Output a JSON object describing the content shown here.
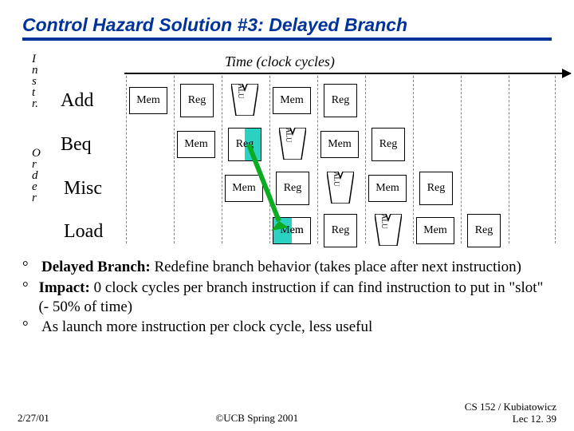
{
  "title": "Control Hazard Solution #3: Delayed Branch",
  "vlabel_top": {
    "c": [
      "I",
      "n",
      "s",
      "t",
      "r."
    ]
  },
  "vlabel_bot": {
    "c": [
      "O",
      "r",
      "d",
      "e",
      "r"
    ]
  },
  "time_label": "Time (clock cycles)",
  "instr": {
    "add": "Add",
    "beq": "Beq",
    "misc": "Misc",
    "load": "Load"
  },
  "stage": {
    "mem": "Mem",
    "reg": "Reg",
    "alu": "ALU"
  },
  "bullets": [
    {
      "lead": "Delayed Branch:",
      "rest": " Redefine branch behavior (takes place after next instruction)"
    },
    {
      "lead": "Impact:",
      "rest": " 0 clock cycles per branch instruction if can find instruction to put in \"slot\" (- 50% of time)"
    },
    {
      "lead": "",
      "rest": "As launch more instruction per clock cycle, less useful"
    }
  ],
  "footer": {
    "left": "2/27/01",
    "center": "©UCB Spring 2001",
    "right1": "CS 152 / Kubiatowicz",
    "right2": "Lec 12. 39"
  }
}
